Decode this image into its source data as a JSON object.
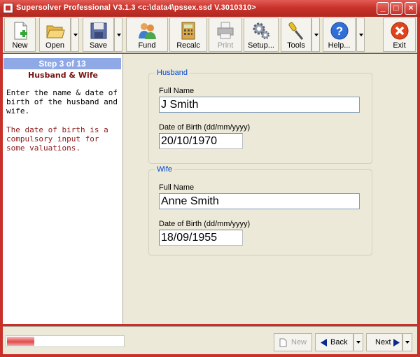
{
  "window": {
    "title": "Supersolver Professional V3.1.3 <c:\\data4\\pssex.ssd V.3010310>",
    "minimize_glyph": "_",
    "maximize_glyph": "□",
    "close_glyph": "×"
  },
  "toolbar": {
    "new_label": "New",
    "open_label": "Open",
    "save_label": "Save",
    "fund_label": "Fund",
    "recalc_label": "Recalc",
    "print_label": "Print",
    "setup_label": "Setup...",
    "tools_label": "Tools",
    "help_label": "Help...",
    "exit_label": "Exit"
  },
  "sidebar": {
    "step_title": "Step 3 of 13",
    "step_subtitle": "Husband & Wife",
    "help_text": "Enter the name & date of birth of the husband and wife.",
    "note_text": "The date of birth is a compulsory input for some valuations."
  },
  "husband": {
    "legend": "Husband",
    "full_name_label": "Full Name",
    "full_name": "J Smith",
    "dob_label": "Date of Birth (dd/mm/yyyy)",
    "dob": "20/10/1970"
  },
  "wife": {
    "legend": "Wife",
    "full_name_label": "Full Name",
    "full_name": "Anne Smith",
    "dob_label": "Date of Birth (dd/mm/yyyy)",
    "dob": "18/09/1955"
  },
  "bottom": {
    "progress_fraction": 0.23,
    "new_label": "New",
    "back_label": "Back",
    "next_label": "Next"
  },
  "colors": {
    "titlebar": "#c8302a",
    "step_header": "#8ea9e6",
    "subtitle": "#7a1212",
    "legend": "#0046d5",
    "progress": "#e24a4a"
  }
}
